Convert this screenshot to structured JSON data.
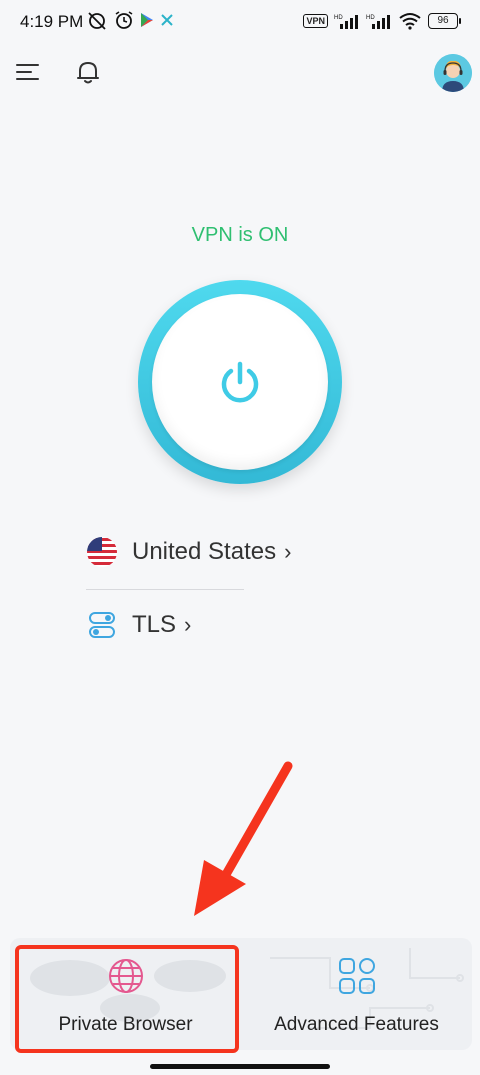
{
  "statusbar": {
    "time": "4:19 PM",
    "vpn_badge": "VPN",
    "network_badge_1": "HD",
    "network_badge_2": "HD",
    "battery": "96",
    "icons": [
      "muted-alarm-icon",
      "alarm-icon",
      "play-store-icon",
      "x-icon",
      "signal-icon",
      "wifi-icon"
    ]
  },
  "topbar": {
    "icons": [
      "menu-icon",
      "bell-icon",
      "support-avatar"
    ]
  },
  "vpn": {
    "status": "VPN is ON",
    "status_color": "#2fbf71",
    "accent": "#3fcbe6"
  },
  "location": {
    "country": "United States",
    "chevron": "›",
    "icon": "us-flag-icon"
  },
  "protocol": {
    "name": "TLS",
    "chevron": "›",
    "icon": "toggles-icon"
  },
  "bottom": {
    "private_browser": "Private Browser",
    "advanced_features": "Advanced Features",
    "highlight_color": "#f5341e"
  }
}
